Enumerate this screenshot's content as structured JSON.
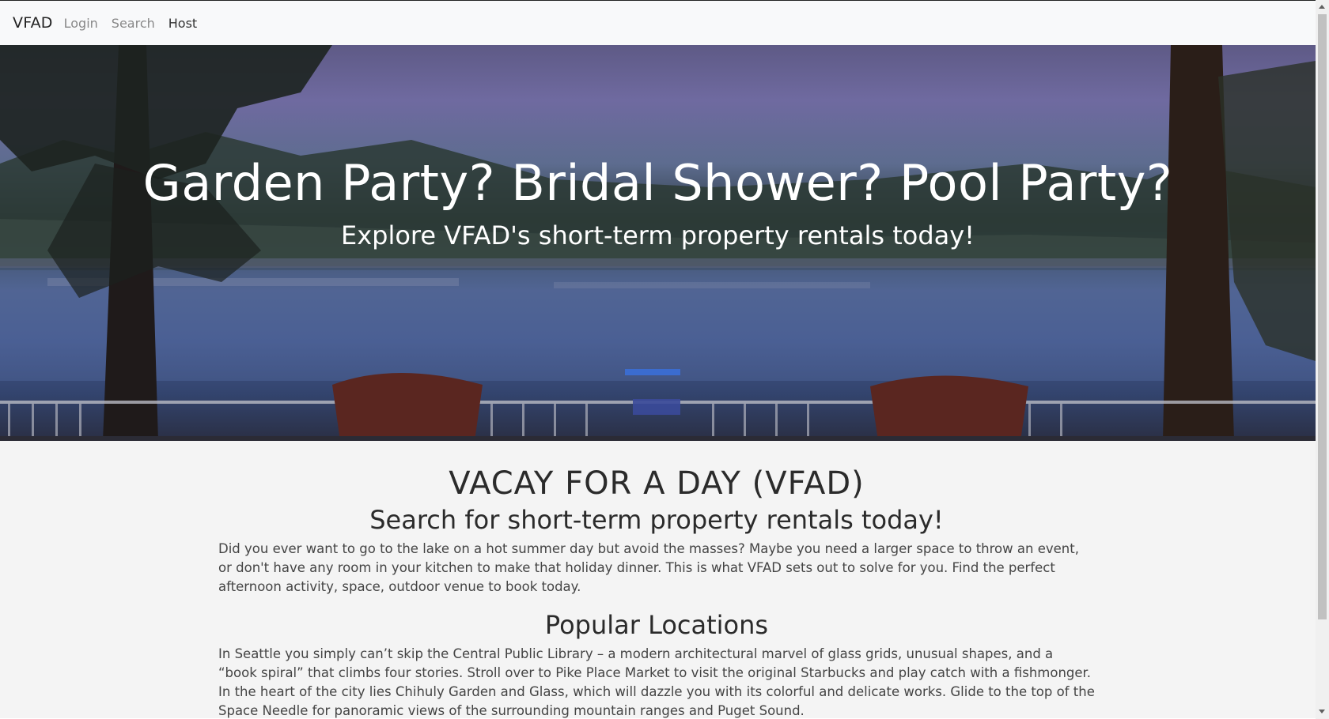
{
  "navbar": {
    "brand": "VFAD",
    "links": [
      {
        "label": "Login"
      },
      {
        "label": "Search"
      },
      {
        "label": "Host"
      }
    ]
  },
  "hero": {
    "title": "Garden Party? Bridal Shower? Pool Party?",
    "subtitle": "Explore VFAD's short-term property rentals today!"
  },
  "main": {
    "heading": "VACAY FOR A DAY (VFAD)",
    "subheading": "Search for short-term property rentals today!",
    "intro": "Did you ever want to go to the lake on a hot summer day but avoid the masses? Maybe you need a larger space to throw an event, or don't have any room in your kitchen to make that holiday dinner. This is what VFAD sets out to solve for you. Find the perfect afternoon activity, space, outdoor venue to book today.",
    "popular_heading": "Popular Locations",
    "popular_text": "In Seattle you simply can’t skip the Central Public Library – a modern architectural marvel of glass grids, unusual shapes, and a “book spiral” that climbs four stories. Stroll over to Pike Place Market to visit the original Starbucks and play catch with a fishmonger. In the heart of the city lies Chihuly Garden and Glass, which will dazzle you with its colorful and delicate works. Glide to the top of the Space Needle for panoramic views of the surrounding mountain ranges and Puget Sound."
  }
}
